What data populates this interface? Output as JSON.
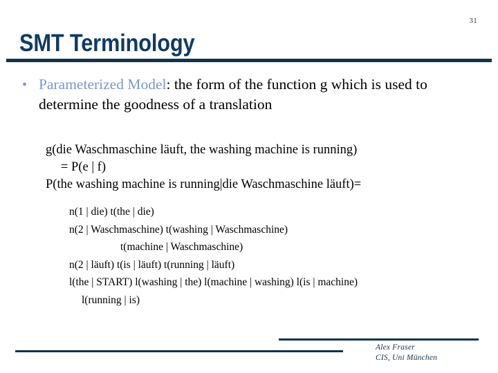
{
  "slide": {
    "page_number": "31",
    "title": "SMT Terminology",
    "accent_color": "#0F3350",
    "title_color": "#103A63",
    "highlight_color": "#7B96D4",
    "body_color": "#000000",
    "background_color": "#ffffff"
  },
  "bullet": {
    "marker": "•",
    "term": "Parameterized Model",
    "definition": ":  the form of the function g which is used to determine the goodness of a translation"
  },
  "equations": {
    "line1": "g(die Waschmaschine läuft, the washing machine is running)",
    "line2": "= P(e | f)",
    "line3": "P(the washing machine is running|die Waschmaschine läuft)="
  },
  "expansion": {
    "line1": "n(1 | die) t(the | die)",
    "line2": "n(2 | Waschmaschine)  t(washing | Waschmaschine)",
    "line3": "t(machine | Waschmaschine)",
    "line4": "n(2 | läuft) t(is | läuft) t(running | läuft)",
    "line5": "l(the | START) l(washing | the) l(machine | washing) l(is | machine)",
    "line6": "l(running | is)"
  },
  "footer": {
    "author": "Alex Fraser",
    "affiliation": "CIS, Uni München"
  }
}
